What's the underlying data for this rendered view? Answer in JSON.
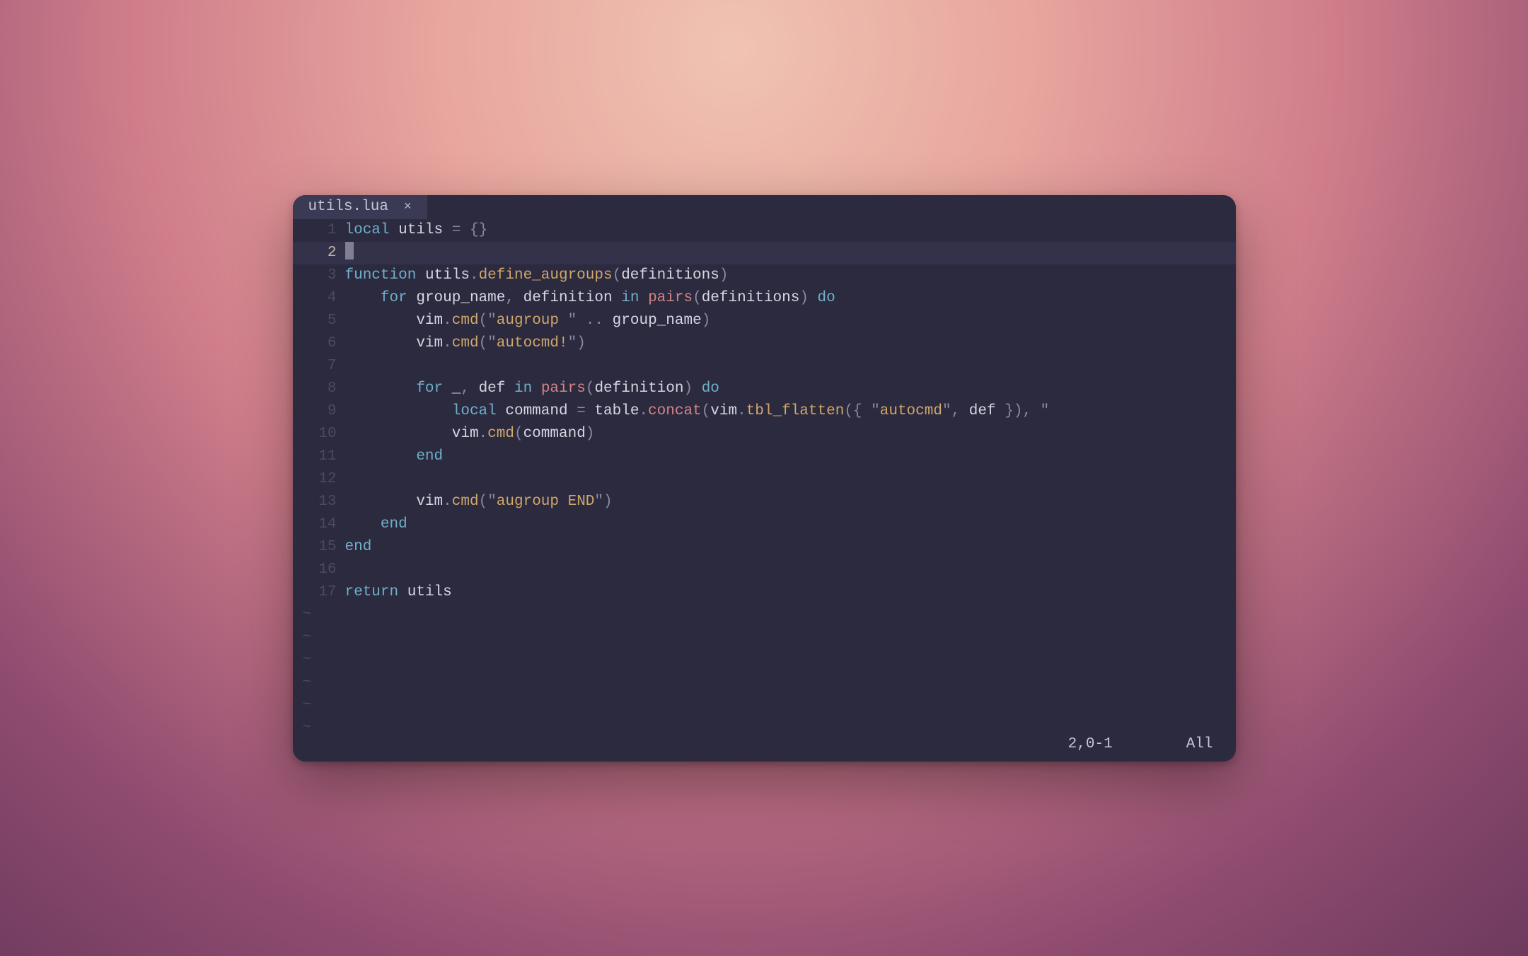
{
  "tab": {
    "filename": "utils.lua",
    "close_glyph": "×"
  },
  "status": {
    "position": "2,0-1",
    "scroll": "All"
  },
  "tilde": "~",
  "code": {
    "l1": {
      "n": "1",
      "kw_local": "local",
      "sp1": " ",
      "ident_utils": "utils",
      "sp2": " ",
      "eq": "=",
      "sp3": " ",
      "lb": "{",
      "rb": "}"
    },
    "l2": {
      "n": "2"
    },
    "l3": {
      "n": "3",
      "kw_function": "function",
      "sp1": " ",
      "obj": "utils",
      "dot": ".",
      "fn": "define_augroups",
      "lp": "(",
      "arg": "definitions",
      "rp": ")"
    },
    "l4": {
      "n": "4",
      "indent": "    ",
      "kw_for": "for",
      "sp1": " ",
      "v1": "group_name",
      "comma": ",",
      "sp2": " ",
      "v2": "definition",
      "sp3": " ",
      "kw_in": "in",
      "sp4": " ",
      "pairs": "pairs",
      "lp": "(",
      "arg": "definitions",
      "rp": ")",
      "sp5": " ",
      "kw_do": "do"
    },
    "l5": {
      "n": "5",
      "indent": "        ",
      "vim": "vim",
      "dot": ".",
      "cmd": "cmd",
      "lp": "(",
      "q1": "\"",
      "s": "augroup ",
      "q2": "\"",
      "sp1": " ",
      "concat": "..",
      "sp2": " ",
      "gn": "group_name",
      "rp": ")"
    },
    "l6": {
      "n": "6",
      "indent": "        ",
      "vim": "vim",
      "dot": ".",
      "cmd": "cmd",
      "lp": "(",
      "q1": "\"",
      "s": "autocmd!",
      "q2": "\"",
      "rp": ")"
    },
    "l7": {
      "n": "7"
    },
    "l8": {
      "n": "8",
      "indent": "        ",
      "kw_for": "for",
      "sp1": " ",
      "us": "_",
      "comma": ",",
      "sp2": " ",
      "def": "def",
      "sp3": " ",
      "kw_in": "in",
      "sp4": " ",
      "pairs": "pairs",
      "lp": "(",
      "arg": "definition",
      "rp": ")",
      "sp5": " ",
      "kw_do": "do"
    },
    "l9": {
      "n": "9",
      "indent": "            ",
      "kw_local": "local",
      "sp1": " ",
      "cmdv": "command",
      "sp2": " ",
      "eq": "=",
      "sp3": " ",
      "tbl": "table",
      "dot": ".",
      "concat": "concat",
      "lp": "(",
      "vim": "vim",
      "dot2": ".",
      "tfl": "tbl_flatten",
      "lp2": "(",
      "lb": "{",
      "sp4": " ",
      "q1": "\"",
      "s": "autocmd",
      "q2": "\"",
      "comma": ",",
      "sp5": " ",
      "def": "def",
      "sp6": " ",
      "rb": "}",
      "rp2": ")",
      "comma2": ",",
      "sp7": " ",
      "q3": "\""
    },
    "l10": {
      "n": "10",
      "indent": "            ",
      "vim": "vim",
      "dot": ".",
      "cmd": "cmd",
      "lp": "(",
      "arg": "command",
      "rp": ")"
    },
    "l11": {
      "n": "11",
      "indent": "        ",
      "kw_end": "end"
    },
    "l12": {
      "n": "12"
    },
    "l13": {
      "n": "13",
      "indent": "        ",
      "vim": "vim",
      "dot": ".",
      "cmd": "cmd",
      "lp": "(",
      "q1": "\"",
      "s": "augroup END",
      "q2": "\"",
      "rp": ")"
    },
    "l14": {
      "n": "14",
      "indent": "    ",
      "kw_end": "end"
    },
    "l15": {
      "n": "15",
      "kw_end": "end"
    },
    "l16": {
      "n": "16"
    },
    "l17": {
      "n": "17",
      "kw_return": "return",
      "sp1": " ",
      "utils": "utils"
    }
  }
}
